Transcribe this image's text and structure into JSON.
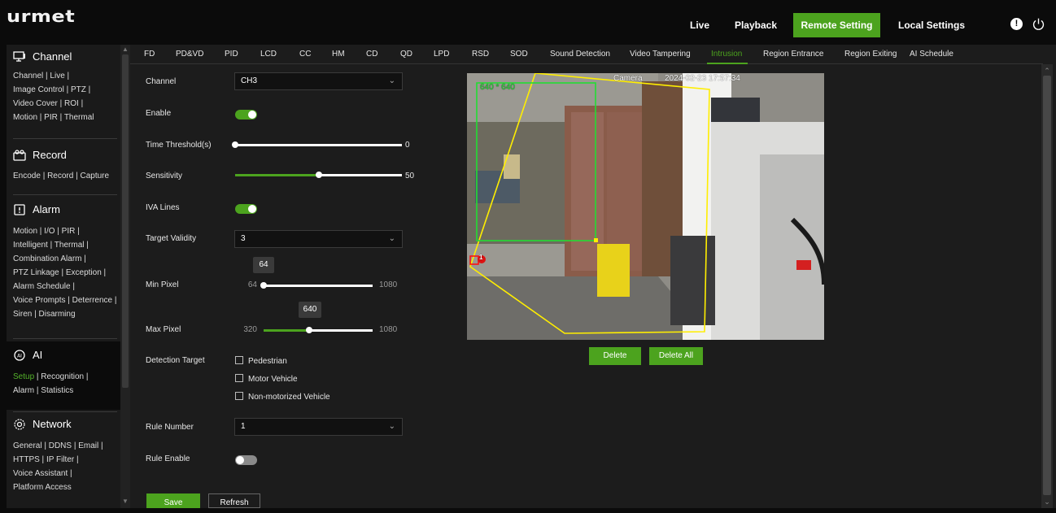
{
  "header": {
    "logo": "urmet",
    "nav": [
      {
        "label": "Live",
        "active": false
      },
      {
        "label": "Playback",
        "active": false
      },
      {
        "label": "Remote Setting",
        "active": true
      },
      {
        "label": "Local Settings",
        "active": false
      }
    ],
    "icons": [
      "alert-icon",
      "power-icon"
    ]
  },
  "sidebar": {
    "sections": [
      {
        "title": "Channel",
        "icon": "channel-icon",
        "lines": [
          [
            "Channel",
            "Live"
          ],
          [
            "Image Control",
            "PTZ"
          ],
          [
            "Video Cover",
            "ROI"
          ],
          [
            "Motion",
            "PIR",
            "Thermal"
          ]
        ]
      },
      {
        "title": "Record",
        "icon": "record-icon",
        "lines": [
          [
            "Encode",
            "Record",
            "Capture"
          ]
        ]
      },
      {
        "title": "Alarm",
        "icon": "alarm-icon",
        "lines": [
          [
            "Motion",
            "I/O",
            "PIR"
          ],
          [
            "Intelligent",
            "Thermal"
          ],
          [
            "Combination Alarm"
          ],
          [
            "PTZ Linkage",
            "Exception"
          ],
          [
            "Alarm Schedule"
          ],
          [
            "Voice Prompts",
            "Deterrence"
          ],
          [
            "Siren",
            "Disarming"
          ]
        ]
      },
      {
        "title": "AI",
        "icon": "ai-icon",
        "lines": [
          [
            "Setup",
            "Recognition"
          ],
          [
            "Alarm",
            "Statistics"
          ]
        ]
      },
      {
        "title": "Network",
        "icon": "network-icon",
        "lines": [
          [
            "General",
            "DDNS",
            "Email"
          ],
          [
            "HTTPS",
            "IP Filter"
          ],
          [
            "Voice Assistant"
          ],
          [
            "Platform Access"
          ]
        ]
      }
    ],
    "active_link": "Setup"
  },
  "tabs": {
    "items": [
      "FD",
      "PD&VD",
      "PID",
      "LCD",
      "CC",
      "HM",
      "CD",
      "QD",
      "LPD",
      "RSD",
      "SOD",
      "Sound Detection",
      "Video Tampering",
      "Intrusion",
      "Region Entrance",
      "Region Exiting",
      "AI Schedule"
    ],
    "active": "Intrusion"
  },
  "form": {
    "channel": {
      "label": "Channel",
      "value": "CH3"
    },
    "enable": {
      "label": "Enable",
      "on": true
    },
    "time_threshold": {
      "label": "Time Threshold(s)",
      "value": "0",
      "fraction": 0.0
    },
    "sensitivity": {
      "label": "Sensitivity",
      "value": "50",
      "fraction": 0.5
    },
    "iva_lines": {
      "label": "IVA Lines",
      "on": true
    },
    "target_validity": {
      "label": "Target Validity",
      "value": "3"
    },
    "min_pixel": {
      "label": "Min Pixel",
      "min": "64",
      "max": "1080",
      "value": "64",
      "fraction": 0.0
    },
    "max_pixel": {
      "label": "Max Pixel",
      "min": "320",
      "max": "1080",
      "value": "640",
      "fraction": 0.421
    },
    "detection_target": {
      "label": "Detection Target",
      "options": [
        "Pedestrian",
        "Motor Vehicle",
        "Non-motorized Vehicle"
      ]
    },
    "rule_number": {
      "label": "Rule Number",
      "value": "1"
    },
    "rule_enable": {
      "label": "Rule Enable",
      "on": false
    }
  },
  "buttons": {
    "save": "Save",
    "refresh": "Refresh",
    "delete": "Delete",
    "delete_all": "Delete All"
  },
  "preview": {
    "camera_name": "Camera",
    "timestamp": "2024-02-23 17:57:34",
    "box_size": "640 * 640",
    "region_label": "1"
  },
  "colors": {
    "accent": "#4ca31e",
    "region_line": "#ffee00",
    "size_box": "#22dd33",
    "marker": "#ff1111"
  }
}
